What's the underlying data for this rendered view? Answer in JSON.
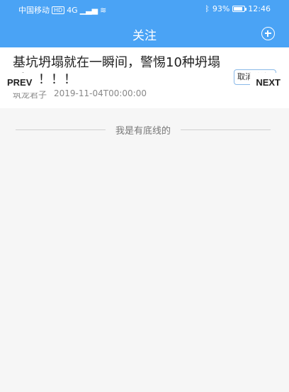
{
  "status_bar": {
    "carrier": "中国移动",
    "hd": "HD",
    "signal": "4G",
    "battery": "93%",
    "time": "12:46"
  },
  "header": {
    "title": "关注"
  },
  "article": {
    "title": "基坑坍塌就在一瞬间，警惕10种坍塌诱因！！！",
    "author": "筑龙君子",
    "date": "2019-11-04T00:00:00",
    "cancel_label": "取消关注"
  },
  "nav": {
    "prev_label": "PREV",
    "next_label": "NEXT"
  },
  "footer": {
    "end_text": "我是有底线的"
  }
}
